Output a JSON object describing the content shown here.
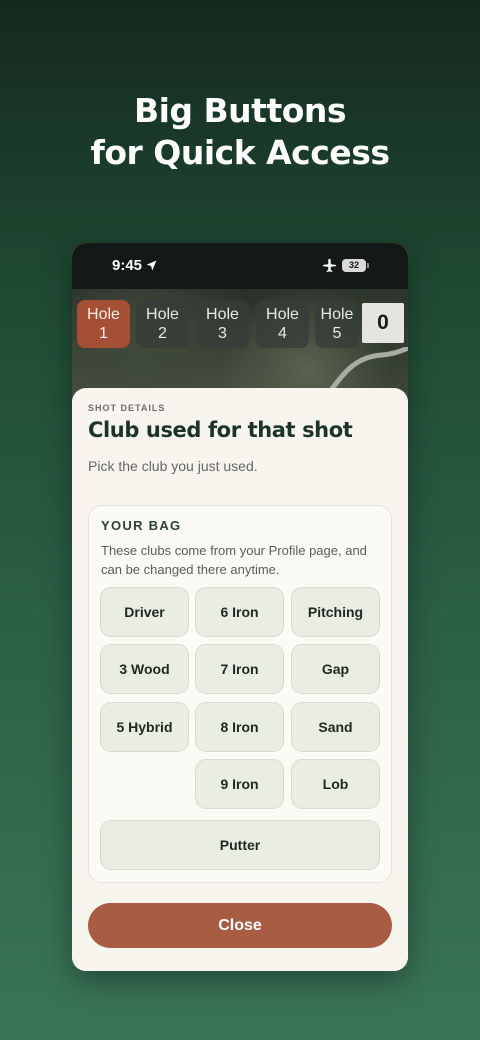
{
  "headline": {
    "line1": "Big Buttons",
    "line2": "for Quick Access"
  },
  "status_bar": {
    "time": "9:45",
    "battery": "32"
  },
  "holes": [
    {
      "word": "Hole",
      "number": "1",
      "active": true
    },
    {
      "word": "Hole",
      "number": "2",
      "active": false
    },
    {
      "word": "Hole",
      "number": "3",
      "active": false
    },
    {
      "word": "Hole",
      "number": "4",
      "active": false
    },
    {
      "word": "Hole",
      "number": "5",
      "active": false
    }
  ],
  "score": "0",
  "sheet": {
    "eyebrow": "SHOT DETAILS",
    "title": "Club used for that shot",
    "subtitle": "Pick the club you just used.",
    "bag": {
      "title": "YOUR BAG",
      "description": "These clubs come from your Profile page, and can be changed there anytime.",
      "clubs": {
        "driver": "Driver",
        "wood3": "3 Wood",
        "hybrid5": "5 Hybrid",
        "iron6": "6 Iron",
        "iron7": "7 Iron",
        "iron8": "8 Iron",
        "iron9": "9 Iron",
        "pitching": "Pitching",
        "gap": "Gap",
        "sand": "Sand",
        "lob": "Lob",
        "putter": "Putter"
      }
    },
    "close_label": "Close"
  },
  "colors": {
    "accent": "#a85c43",
    "active_hole": "#a54f34",
    "title_green": "#1c3426"
  }
}
